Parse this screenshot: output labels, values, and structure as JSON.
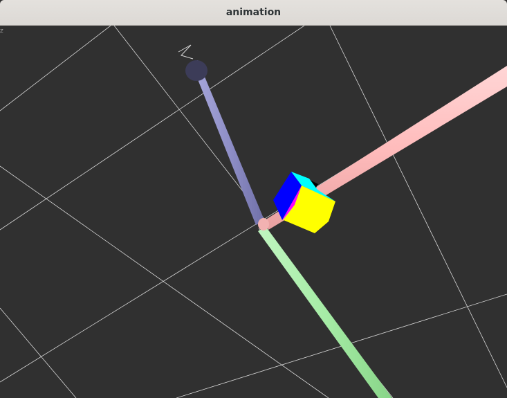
{
  "window": {
    "title": "animation"
  },
  "viewport": {
    "corner_label": "z",
    "background_color": "#303030",
    "grid_color": "#d8d8d8"
  },
  "axes": {
    "x_axis_color": "#ffc0c0",
    "y_axis_color": "#a8eea8",
    "z_axis_color": "#9a9ad0"
  },
  "cube": {
    "face_colors": [
      "#ffff00",
      "#0000ff",
      "#00ffff",
      "#ff00ff",
      "#000000"
    ]
  }
}
